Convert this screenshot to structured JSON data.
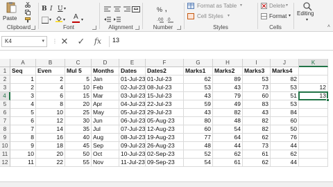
{
  "ribbon": {
    "clipboard": {
      "paste_label": "Paste",
      "group_label": "Clipboard"
    },
    "font": {
      "group_label": "Font",
      "bold": "B",
      "italic": "I",
      "underline": "U",
      "font_color_letter": "A"
    },
    "alignment": {
      "group_label": "Alignment"
    },
    "number": {
      "group_label": "Number",
      "percent": "%"
    },
    "styles": {
      "format_as_table": "Format as Table",
      "cell_styles": "Cell Styles",
      "group_label": "Styles"
    },
    "cells": {
      "delete_label": "Delete",
      "format_label": "Format",
      "group_label": "Cells"
    },
    "editing": {
      "label": "Editing"
    }
  },
  "formula_bar": {
    "name_box": "K4",
    "fx": "fx",
    "content": "13"
  },
  "colors": {
    "accent": "#217346",
    "font_color_bar": "#c00000"
  },
  "grid": {
    "columns": [
      {
        "letter": "A",
        "w": 37
      },
      {
        "letter": "B",
        "w": 42
      },
      {
        "letter": "C",
        "w": 38
      },
      {
        "letter": "D",
        "w": 40
      },
      {
        "letter": "E",
        "w": 38
      },
      {
        "letter": "F",
        "w": 55
      },
      {
        "letter": "G",
        "w": 42
      },
      {
        "letter": "H",
        "w": 43
      },
      {
        "letter": "I",
        "w": 40
      },
      {
        "letter": "J",
        "w": 41
      },
      {
        "letter": "K",
        "w": 42
      }
    ],
    "headers": [
      "Seq",
      "Even",
      "Mul 5",
      "Months",
      "Dates",
      "Dates2",
      "Marks1",
      "Marks2",
      "Marks3",
      "Marks4",
      ""
    ],
    "rows": [
      [
        "1",
        "2",
        "5",
        "Jan",
        "01-Jul-23",
        "01-Jul-23",
        "62",
        "89",
        "53",
        "82",
        ""
      ],
      [
        "2",
        "4",
        "10",
        "Feb",
        "02-Jul-23",
        "08-Jul-23",
        "53",
        "43",
        "73",
        "53",
        "12"
      ],
      [
        "3",
        "6",
        "15",
        "Mar",
        "03-Jul-23",
        "15-Jul-23",
        "43",
        "79",
        "60",
        "51",
        "13"
      ],
      [
        "4",
        "8",
        "20",
        "Apr",
        "04-Jul-23",
        "22-Jul-23",
        "59",
        "49",
        "83",
        "53",
        ""
      ],
      [
        "5",
        "10",
        "25",
        "May",
        "05-Jul-23",
        "29-Jul-23",
        "43",
        "82",
        "43",
        "84",
        ""
      ],
      [
        "6",
        "12",
        "30",
        "Jun",
        "06-Jul-23",
        "05-Aug-23",
        "80",
        "48",
        "82",
        "60",
        ""
      ],
      [
        "7",
        "14",
        "35",
        "Jul",
        "07-Jul-23",
        "12-Aug-23",
        "60",
        "54",
        "82",
        "50",
        ""
      ],
      [
        "8",
        "16",
        "40",
        "Aug",
        "08-Jul-23",
        "19-Aug-23",
        "77",
        "64",
        "62",
        "76",
        ""
      ],
      [
        "9",
        "18",
        "45",
        "Sep",
        "09-Jul-23",
        "26-Aug-23",
        "48",
        "44",
        "73",
        "44",
        ""
      ],
      [
        "10",
        "20",
        "50",
        "Oct",
        "10-Jul-23",
        "02-Sep-23",
        "52",
        "62",
        "61",
        "62",
        ""
      ],
      [
        "11",
        "22",
        "55",
        "Nov",
        "11-Jul-23",
        "09-Sep-23",
        "54",
        "61",
        "62",
        "44",
        ""
      ]
    ],
    "text_columns": [
      3,
      4,
      5
    ],
    "active": {
      "row": 3,
      "col": 10
    }
  }
}
